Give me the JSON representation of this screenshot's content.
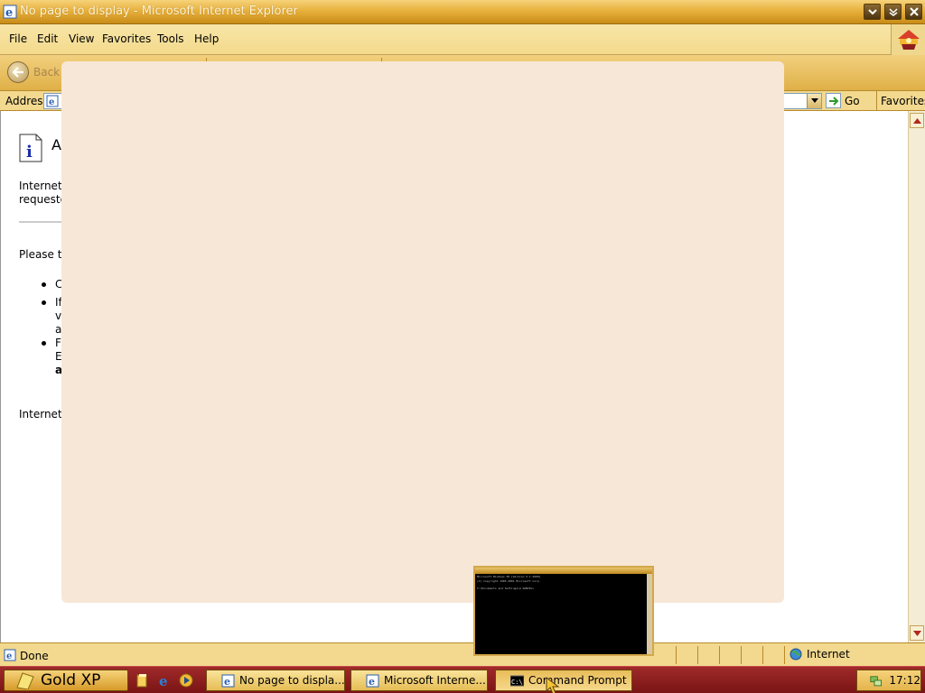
{
  "window": {
    "title": "No page to display - Microsoft Internet Explorer"
  },
  "menu": [
    "File",
    "Edit",
    "View",
    "Favorites",
    "Tools",
    "Help"
  ],
  "toolbar": {
    "back_label": "Back"
  },
  "address": {
    "label": "Address",
    "value": "",
    "go_label": "Go",
    "favorites_label": "Favorites"
  },
  "page": {
    "heading": "A",
    "para1_line1": "Internet",
    "para1_line2": "requeste",
    "para2": "Please tr",
    "bullets": [
      {
        "lines": [
          "C"
        ]
      },
      {
        "lines": [
          "If",
          "v",
          "a"
        ]
      },
      {
        "lines": [
          "F",
          "E",
          "a"
        ]
      }
    ],
    "para3": "Internet"
  },
  "status": {
    "text": "Done",
    "zone": "Internet"
  },
  "cmd_window": {
    "lines": [
      "Microsoft Windows XP [Version 5.1.2600]",
      "(C) Copyright 1985-2001 Microsoft Corp.",
      "C:\\Documents and Settings\\A DANIEL>"
    ]
  },
  "taskbar": {
    "start_label": "Gold XP",
    "tasks": [
      {
        "label": "No page to displa...",
        "icon": "ie-icon"
      },
      {
        "label": "Microsoft Interne...",
        "icon": "ie-icon"
      },
      {
        "label": "Command Prompt",
        "icon": "cmd-icon"
      }
    ],
    "clock": "17:12"
  },
  "colors": {
    "title_gradient_top": "#f6d27a",
    "taskbar": "#7a1414",
    "overlay": "#f7e7d6"
  }
}
